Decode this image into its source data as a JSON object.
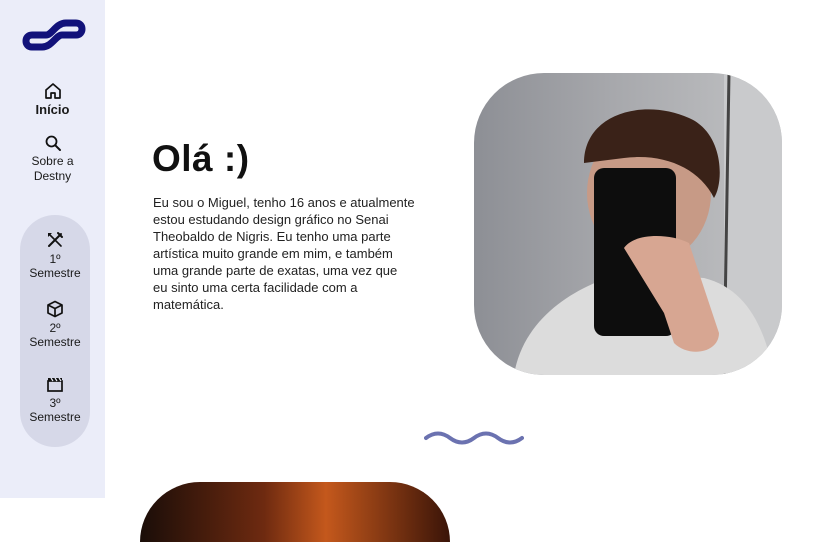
{
  "sidebar": {
    "home_label": "Início",
    "about_label_line1": "Sobre a",
    "about_label_line2": "Destny",
    "semesters": [
      {
        "number": "1º",
        "label": "Semestre",
        "icon": "design-tools-icon"
      },
      {
        "number": "2º",
        "label": "Semestre",
        "icon": "cube-icon"
      },
      {
        "number": "3º",
        "label": "Semestre",
        "icon": "clapperboard-icon"
      }
    ]
  },
  "main": {
    "title": "Olá :)",
    "about_text": "Eu sou o Miguel, tenho 16 anos e atualmente estou estudando design gráfico no Senai Theobaldo de Nigris. Eu tenho uma parte artística muito grande em mim, e também uma grande parte de exatas, uma vez que eu sinto uma certa facilidade com a matemática."
  },
  "colors": {
    "sidebar_bg": "#ebedf9",
    "pill_bg": "#d6d8e8",
    "logo": "#12127a",
    "wave": "#6b72b0"
  }
}
